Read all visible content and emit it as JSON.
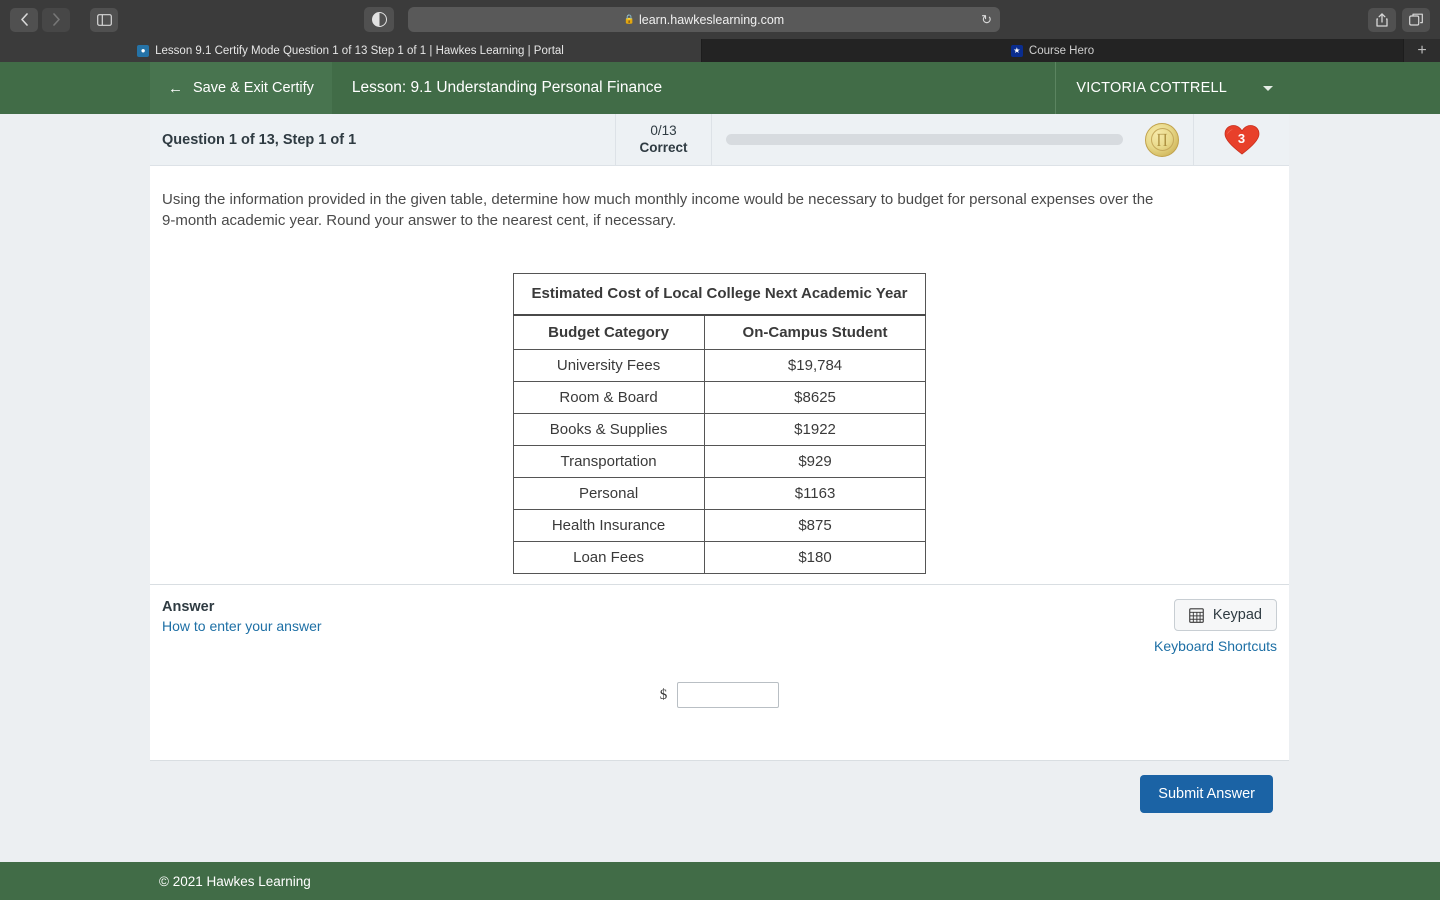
{
  "browser": {
    "back_icon": "chevron-left-icon",
    "forward_icon": "chevron-right-icon",
    "sidebar_icon": "sidebar-toggle-icon",
    "reader_icon": "reader-contrast-icon",
    "lock_glyph": "🔒",
    "url": "learn.hawkeslearning.com",
    "reload_glyph": "↻",
    "share_icon": "share-icon",
    "tabs_overview_icon": "tab-overview-icon",
    "new_tab_glyph": "+"
  },
  "tabs": [
    {
      "title": "Lesson 9.1 Certify Mode Question 1 of 13 Step 1 of 1 | Hawkes Learning | Portal",
      "favicon": "hawkes-favicon",
      "active": true
    },
    {
      "title": "Course Hero",
      "favicon": "coursehero-favicon",
      "active": false
    }
  ],
  "header": {
    "save_exit_label": "Save & Exit Certify",
    "back_arrow": "←",
    "lesson_title": "Lesson: 9.1 Understanding Personal Finance",
    "user_name": "VICTORIA COTTRELL",
    "user_caret": "chevron-down-icon"
  },
  "status": {
    "question_label": "Question 1 of 13, Step 1 of 1",
    "correct_count": "0/13",
    "correct_word": "Correct",
    "progress_percent": 0,
    "coin_symbol": "coin-icon",
    "hearts_remaining": "3"
  },
  "question": {
    "text": "Using the information provided in the given table, determine how much monthly income would be necessary to budget for personal expenses over the 9-month academic year. Round your answer to the nearest cent, if necessary."
  },
  "table": {
    "title": "Estimated Cost of Local College Next Academic Year",
    "headers": [
      "Budget Category",
      "On-Campus Student"
    ],
    "rows": [
      [
        "University Fees",
        "$19,784"
      ],
      [
        "Room & Board",
        "$8625"
      ],
      [
        "Books & Supplies",
        "$1922"
      ],
      [
        "Transportation",
        "$929"
      ],
      [
        "Personal",
        "$1163"
      ],
      [
        "Health Insurance",
        "$875"
      ],
      [
        "Loan Fees",
        "$180"
      ]
    ]
  },
  "answer": {
    "title": "Answer",
    "how_to_link": "How to enter your answer",
    "keypad_label": "Keypad",
    "keypad_icon": "keypad-grid-icon",
    "keyboard_shortcuts_label": "Keyboard Shortcuts",
    "dollar_prefix": "$",
    "input_value": "",
    "input_placeholder": ""
  },
  "actions": {
    "submit_label": "Submit Answer"
  },
  "footer": {
    "copyright": "© 2021 Hawkes Learning"
  },
  "colors": {
    "brand_green": "#416c47",
    "accent_blue": "#1b63a5",
    "link_blue": "#1d6fa5",
    "heart_red": "#e8402a",
    "coin_gold": "#d4bc63"
  }
}
